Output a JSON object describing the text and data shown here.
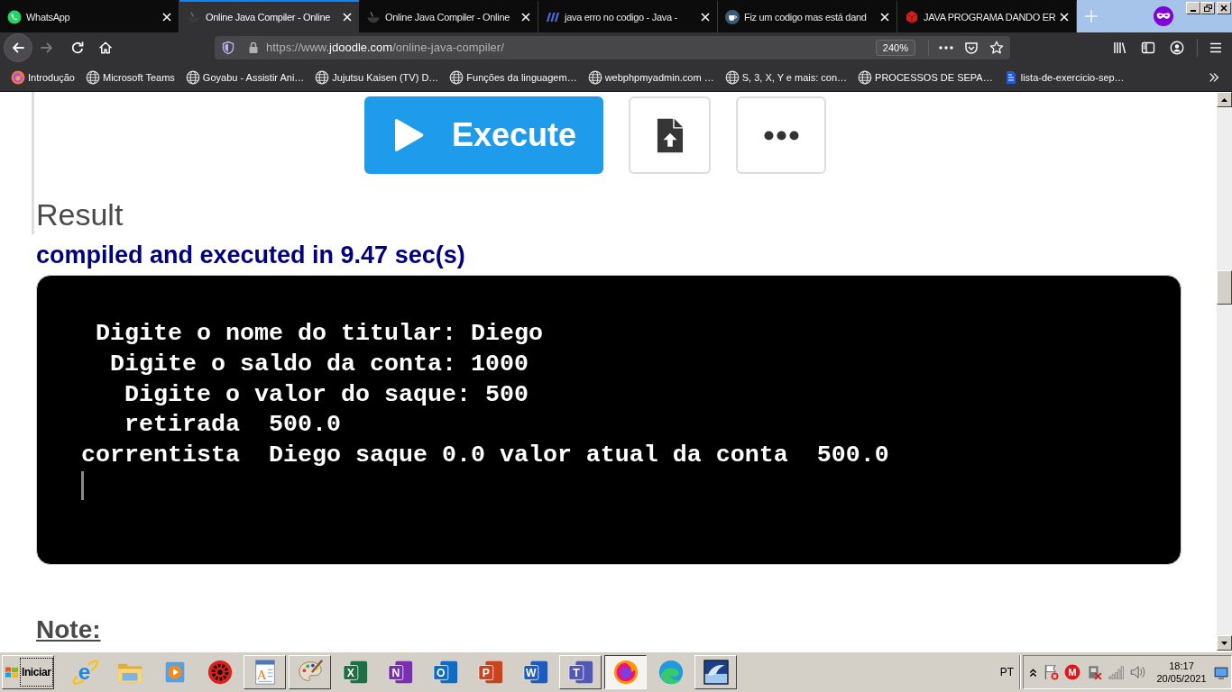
{
  "browser": {
    "tabs": [
      {
        "kind": "chat",
        "title": "WhatsApp",
        "selected": false
      },
      {
        "kind": "compiler",
        "title": "Online Java Compiler - Online",
        "selected": true
      },
      {
        "kind": "compiler",
        "title": "Online Java Compiler - Online",
        "selected": false
      },
      {
        "kind": "logo",
        "title": "java erro no codigo - Java -",
        "selected": false
      },
      {
        "kind": "cup",
        "title": "Fiz um codigo mas está dand",
        "selected": false
      },
      {
        "kind": "cube",
        "title": "JAVA PROGRAMA DANDO ER",
        "selected": false
      }
    ],
    "navigation": [
      {
        "kind": "back",
        "disabled": false
      },
      {
        "kind": "forward",
        "disabled": true
      },
      {
        "kind": "reload",
        "disabled": false
      },
      {
        "kind": "home",
        "disabled": false
      }
    ],
    "address": {
      "scheme": "https://www.",
      "domain": "jdoodle.com",
      "path": "/online-java-compiler/",
      "zoom": "240%"
    },
    "bookmarks": [
      {
        "kind": "fox",
        "label": "Introdução"
      },
      {
        "kind": "globe",
        "label": "Microsoft Teams"
      },
      {
        "kind": "globe",
        "label": "Goyabu - Assistir Ani…"
      },
      {
        "kind": "globe",
        "label": "Jujutsu Kaisen (TV) D…"
      },
      {
        "kind": "globe",
        "label": "Funções da linguagem…"
      },
      {
        "kind": "globe",
        "label": "webphpmyadmin.com …"
      },
      {
        "kind": "globe",
        "label": "S, 3, X, Y e mais: con…"
      },
      {
        "kind": "globe",
        "label": "PROCESSOS DE SEPA…"
      },
      {
        "kind": "doc",
        "label": "lista-de-exercicio-sep…"
      }
    ]
  },
  "page": {
    "execute_label": "Execute",
    "result_heading": "Result",
    "status": "compiled and executed in 9.47 sec(s)",
    "console": {
      "lines": [
        " Digite o nome do titular: Diego",
        "  Digite o saldo da conta: 1000",
        "   Digite o valor do saque: 500",
        "   retirada  500.0",
        "correntista  Diego saque 0.0 valor atual da conta  500.0"
      ],
      "cursor": true
    },
    "note_heading": "Note:"
  },
  "taskbar": {
    "start_label": "Iniciar",
    "apps": [
      {
        "kind": "orbit",
        "letter": "e",
        "open": false,
        "selected": false
      },
      {
        "kind": "folder",
        "open": false,
        "selected": false
      },
      {
        "kind": "media",
        "open": false,
        "selected": false
      },
      {
        "kind": "gear",
        "open": false,
        "selected": false
      },
      {
        "kind": "document",
        "letter": "A",
        "open": true,
        "selected": false
      },
      {
        "kind": "palette",
        "open": true,
        "selected": false
      },
      {
        "kind": "tile",
        "letter": "X",
        "color": "#1d7044",
        "open": false,
        "selected": false
      },
      {
        "kind": "tile",
        "letter": "N",
        "color": "#7a2fb0",
        "open": false,
        "selected": false
      },
      {
        "kind": "tile",
        "letter": "O",
        "color": "#0e6cc4",
        "open": false,
        "selected": false
      },
      {
        "kind": "tile",
        "letter": "P",
        "color": "#c9431f",
        "open": false,
        "selected": false
      },
      {
        "kind": "tile",
        "letter": "W",
        "color": "#1d5cbf",
        "open": false,
        "selected": false
      },
      {
        "kind": "tile",
        "letter": "T",
        "color": "#5358b8",
        "open": true,
        "selected": false
      },
      {
        "kind": "fox",
        "open": true,
        "selected": true
      },
      {
        "kind": "swirl",
        "open": false,
        "selected": false
      },
      {
        "kind": "dolphin",
        "open": true,
        "selected": false
      }
    ],
    "tray": {
      "language": "PT",
      "icons": [
        {
          "kind": "chevron"
        },
        {
          "kind": "flag"
        },
        {
          "kind": "disc",
          "letter": "M"
        },
        {
          "kind": "plug"
        },
        {
          "kind": "signal"
        },
        {
          "kind": "speaker"
        }
      ],
      "time": "18:17",
      "date": "20/05/2021"
    }
  }
}
